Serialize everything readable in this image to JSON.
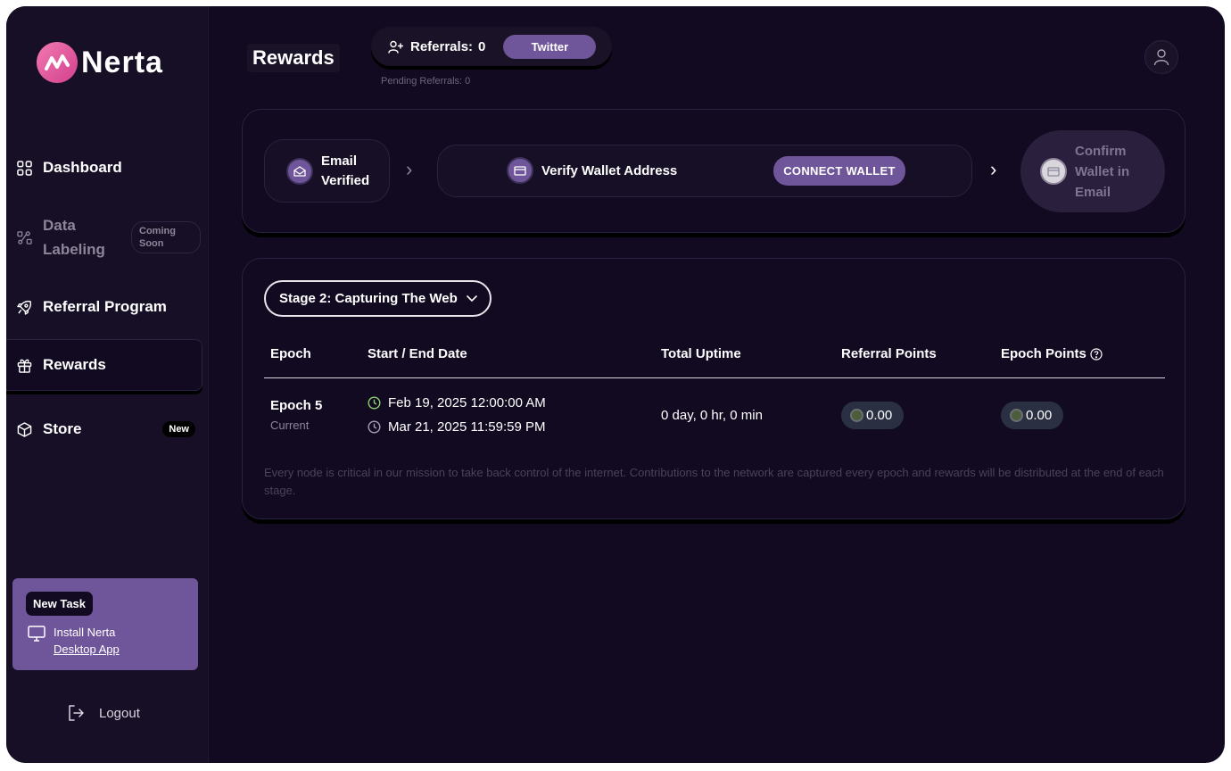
{
  "brand": {
    "name": "Nerta"
  },
  "sidebar": {
    "items": [
      {
        "label": "Dashboard",
        "icon": "grid-icon"
      },
      {
        "label": "Data Labeling",
        "icon": "data-labeling-icon",
        "badge": "Coming Soon"
      },
      {
        "label": "Referral Program",
        "icon": "rocket-icon"
      },
      {
        "label": "Rewards",
        "icon": "gift-icon",
        "active": true
      },
      {
        "label": "Store",
        "icon": "cube-icon",
        "badge": "New"
      }
    ],
    "task": {
      "tag": "New Task",
      "line1": "Install Nerta",
      "link": "Desktop App"
    },
    "logout": "Logout"
  },
  "header": {
    "title": "Rewards",
    "referrals_label": "Referrals:",
    "referrals_count": "0",
    "twitter_label": "Twitter",
    "pending": "Pending Referrals: 0"
  },
  "steps": {
    "email": "Email Verified",
    "verify": "Verify Wallet Address",
    "connect": "CONNECT WALLET",
    "confirm": "Confirm Wallet in Email"
  },
  "rewards": {
    "stage": "Stage 2: Capturing The Web",
    "columns": [
      "Epoch",
      "Start / End Date",
      "Total Uptime",
      "Referral Points",
      "Epoch Points"
    ],
    "row": {
      "epoch": "Epoch 5",
      "status": "Current",
      "start": "Feb 19, 2025 12:00:00 AM",
      "end": "Mar 21, 2025 11:59:59 PM",
      "uptime": "0 day, 0 hr, 0 min",
      "referral_points": "0.00",
      "epoch_points": "0.00"
    },
    "footnote": "Every node is critical in our mission to take back control of the internet. Contributions to the network are captured every epoch and rewards will be distributed at the end of each stage."
  },
  "colors": {
    "background": "#110a21",
    "sidebar": "#160f26",
    "accent": "#6f5599",
    "logo": "#e8579b",
    "start_clock": "#8dd16a"
  }
}
